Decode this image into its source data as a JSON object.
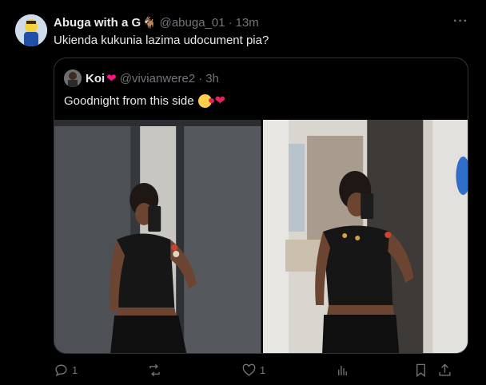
{
  "tweet": {
    "author_name": "Abuga with a G",
    "author_badge_icon": "goat-icon",
    "handle": "@abuga_01",
    "separator": "·",
    "time": "13m",
    "text": "Ukienda kukunia lazima udocument pia?",
    "more_label": "···"
  },
  "quote": {
    "author_name": "Koi",
    "author_badge_icon": "heart-icon",
    "handle": "@vivianwere2",
    "separator": "·",
    "time": "3h",
    "text": "Goodnight from this side",
    "emojis": [
      "kissing-face-icon",
      "red-heart-icon"
    ],
    "photo_count": 2
  },
  "actions": {
    "reply_count": "1",
    "repost_count": "",
    "like_count": "1",
    "views_count": ""
  },
  "colors": {
    "background": "#000000",
    "text": "#e7e9ea",
    "muted": "#71767b",
    "border": "#2f3336",
    "heart": "#f91880"
  }
}
